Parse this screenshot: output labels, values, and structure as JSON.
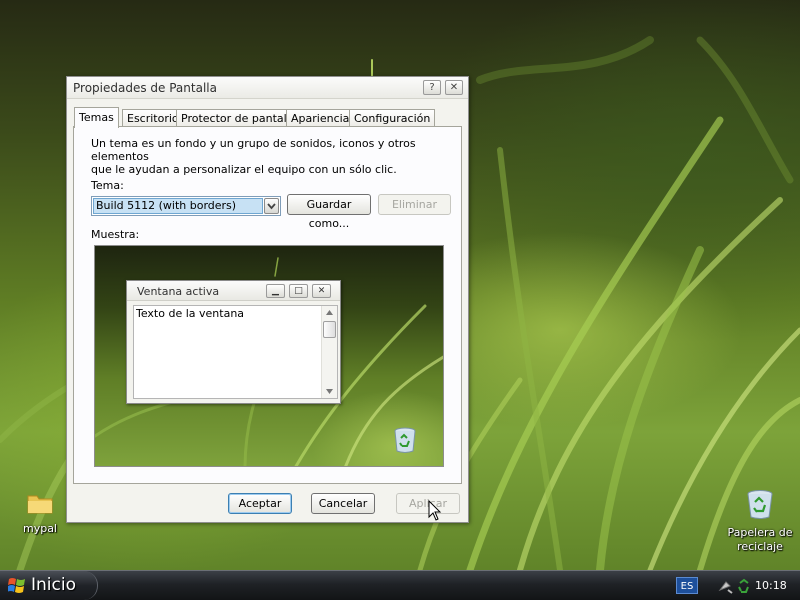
{
  "desktop": {
    "icons": [
      {
        "label": "mypal",
        "icon": "folder-icon"
      },
      {
        "label": "Papelera de\nreciclaje",
        "label_line1": "Papelera de",
        "label_line2": "reciclaje",
        "icon": "recycle-bin-icon"
      }
    ]
  },
  "dialog": {
    "title": "Propiedades de Pantalla",
    "help_glyph": "?",
    "close_glyph": "✕",
    "tabs": [
      {
        "label": "Temas",
        "active": true
      },
      {
        "label": "Escritorio",
        "active": false
      },
      {
        "label": "Protector de pantalla",
        "active": false
      },
      {
        "label": "Apariencia",
        "active": false
      },
      {
        "label": "Configuración",
        "active": false
      }
    ],
    "description_line1": "Un tema es un fondo y un grupo de sonidos, iconos y otros elementos",
    "description_line2": "que le ayudan a personalizar el equipo con un sólo clic.",
    "theme_label": "Tema:",
    "theme_value": "Build 5112 (with borders)",
    "save_as_label": "Guardar como...",
    "delete_label": "Eliminar",
    "sample_label": "Muestra:",
    "preview": {
      "window_title": "Ventana activa",
      "window_text": "Texto de la ventana",
      "minimize_glyph": "▁",
      "maximize_glyph": "□",
      "close_glyph": "✕"
    },
    "ok_label": "Aceptar",
    "cancel_label": "Cancelar",
    "apply_label": "Aplicar"
  },
  "taskbar": {
    "start_label": "Inicio",
    "language": "ES",
    "clock": "10:18"
  }
}
